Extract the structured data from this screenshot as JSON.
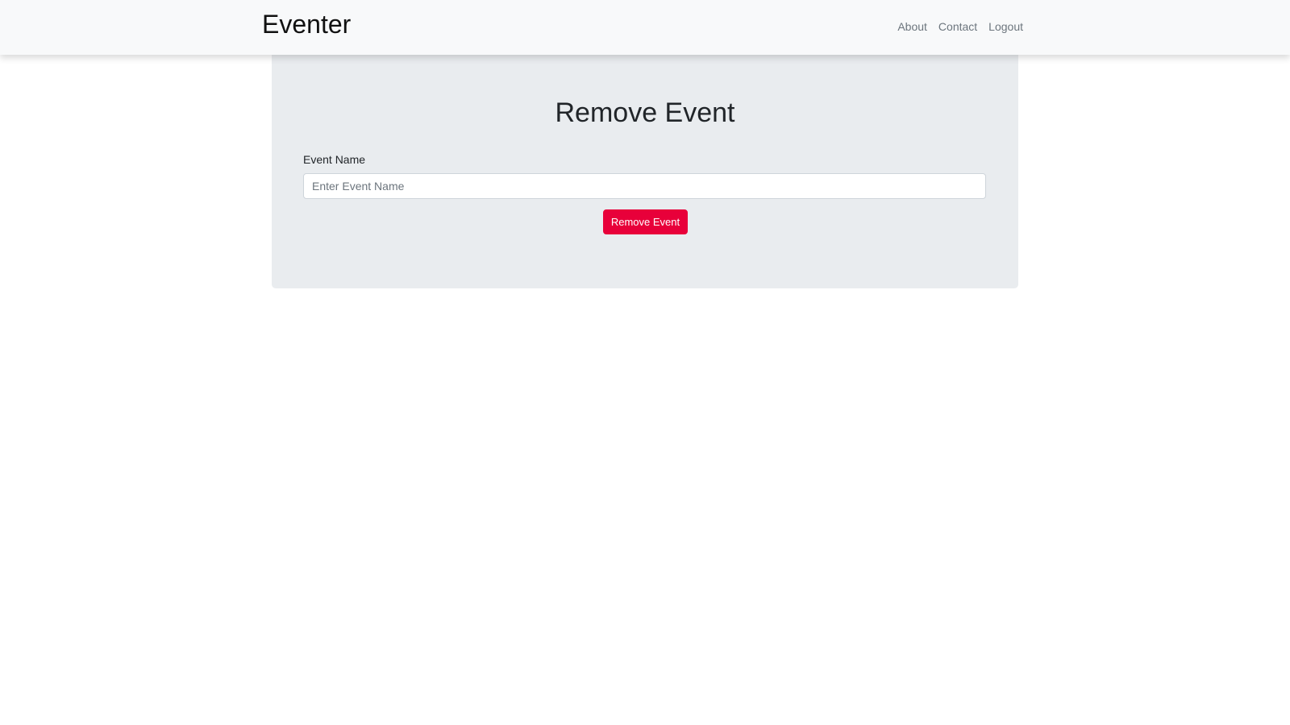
{
  "navbar": {
    "brand": "Eventer",
    "links": [
      {
        "label": "About"
      },
      {
        "label": "Contact"
      },
      {
        "label": "Logout"
      }
    ]
  },
  "form": {
    "title": "Remove Event",
    "event_name_label": "Event Name",
    "event_name_value": "",
    "event_name_placeholder": "Enter Event Name",
    "submit_label": "Remove Event"
  },
  "colors": {
    "navbar_bg": "#f8f9fa",
    "panel_bg": "#e9ecef",
    "danger_button": "#e8003a",
    "link_text": "#6c757d"
  }
}
